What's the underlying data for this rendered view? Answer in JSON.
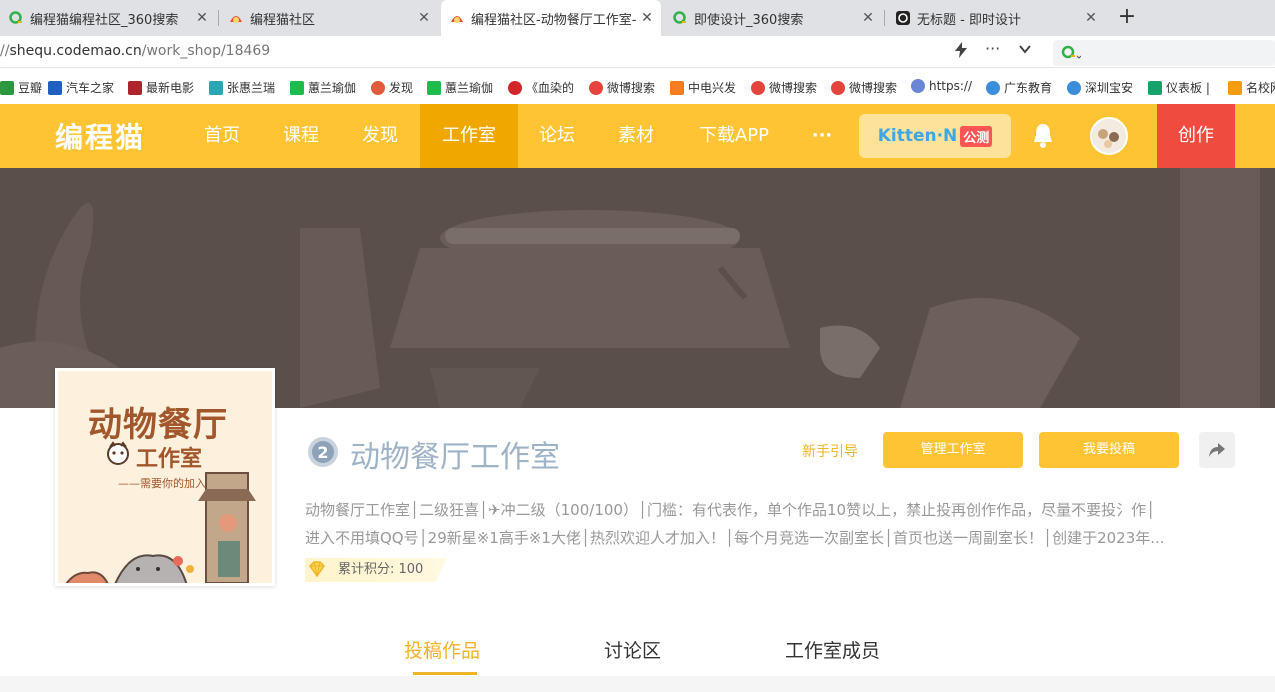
{
  "browser": {
    "tabs": [
      {
        "title": "编程猫编程社区_360搜索",
        "icon": "360-search-icon"
      },
      {
        "title": "编程猫社区",
        "icon": "codemao-icon"
      },
      {
        "title": "编程猫社区-动物餐厅工作室--",
        "icon": "codemao-icon"
      },
      {
        "title": "即使设计_360搜索",
        "icon": "360-search-icon"
      },
      {
        "title": "无标题 - 即时设计",
        "icon": "jishi-design-icon"
      }
    ],
    "new_tab": "+",
    "close_glyph": "✕",
    "url_dim": "//",
    "url_host": "shequ.codemao.cn",
    "url_path": "/work_shop/18469"
  },
  "bookmarks": [
    {
      "label": "豆瓣",
      "color": "#2e963d"
    },
    {
      "label": "汽车之家",
      "color": "#1f5fbf"
    },
    {
      "label": "最新电影",
      "color": "#b1232a"
    },
    {
      "label": "张惠兰瑞",
      "color": "#2aa5b5"
    },
    {
      "label": "蕙兰瑜伽",
      "color": "#1fbb4c"
    },
    {
      "label": "发现",
      "color": "#e15b3a"
    },
    {
      "label": "蕙兰瑜伽",
      "color": "#1fbb4c"
    },
    {
      "label": "《血染的",
      "color": "#d2262b"
    },
    {
      "label": "微博搜索",
      "color": "#e5443c"
    },
    {
      "label": "中电兴发",
      "color": "#f57c1f"
    },
    {
      "label": "微博搜索",
      "color": "#e5443c"
    },
    {
      "label": "微博搜索",
      "color": "#e5443c"
    },
    {
      "label": "https://",
      "color": "#6b86d6"
    },
    {
      "label": "广东教育",
      "color": "#3b8edb"
    },
    {
      "label": "深圳宝安",
      "color": "#3b8edb"
    },
    {
      "label": "仪表板 |",
      "color": "#15a36a"
    },
    {
      "label": "名校网",
      "color": "#f39c12"
    }
  ],
  "site_nav": {
    "logo": "编程猫",
    "items": [
      "首页",
      "课程",
      "发现",
      "工作室",
      "论坛",
      "素材",
      "下载APP",
      "···"
    ],
    "active_item": "工作室",
    "kitten_label": "Kitten·N",
    "kitten_badge": "公测",
    "create_label": "创作"
  },
  "studio": {
    "cover_title": "动物餐厅",
    "cover_subtitle": "工作室",
    "cover_tagline": "——需要你的加入——",
    "level": "2",
    "name": "动物餐厅工作室",
    "guide_label": "新手引导",
    "manage_label": "管理工作室",
    "submit_label": "我要投稿",
    "description_line1": "动物餐厅工作室│二级狂喜│✈冲二级（100/100）│门槛：有代表作，单个作品10赞以上，禁止投再创作作品，尽量不要投氵作│",
    "description_line2": "进入不用填QQ号│29新星※1高手※1大佬│热烈欢迎人才加入！│每个月竞选一次副室长│首页也送一周副室长！│创建于2023年...",
    "points_label": "累计积分: 100",
    "points": 100
  },
  "content_tabs": [
    "投稿作品",
    "讨论区",
    "工作室成员"
  ],
  "active_content_tab": "投稿作品",
  "colors": {
    "brand_yellow": "#fec433",
    "create_red": "#ef4b3f",
    "active_orange": "#f0b42a"
  }
}
